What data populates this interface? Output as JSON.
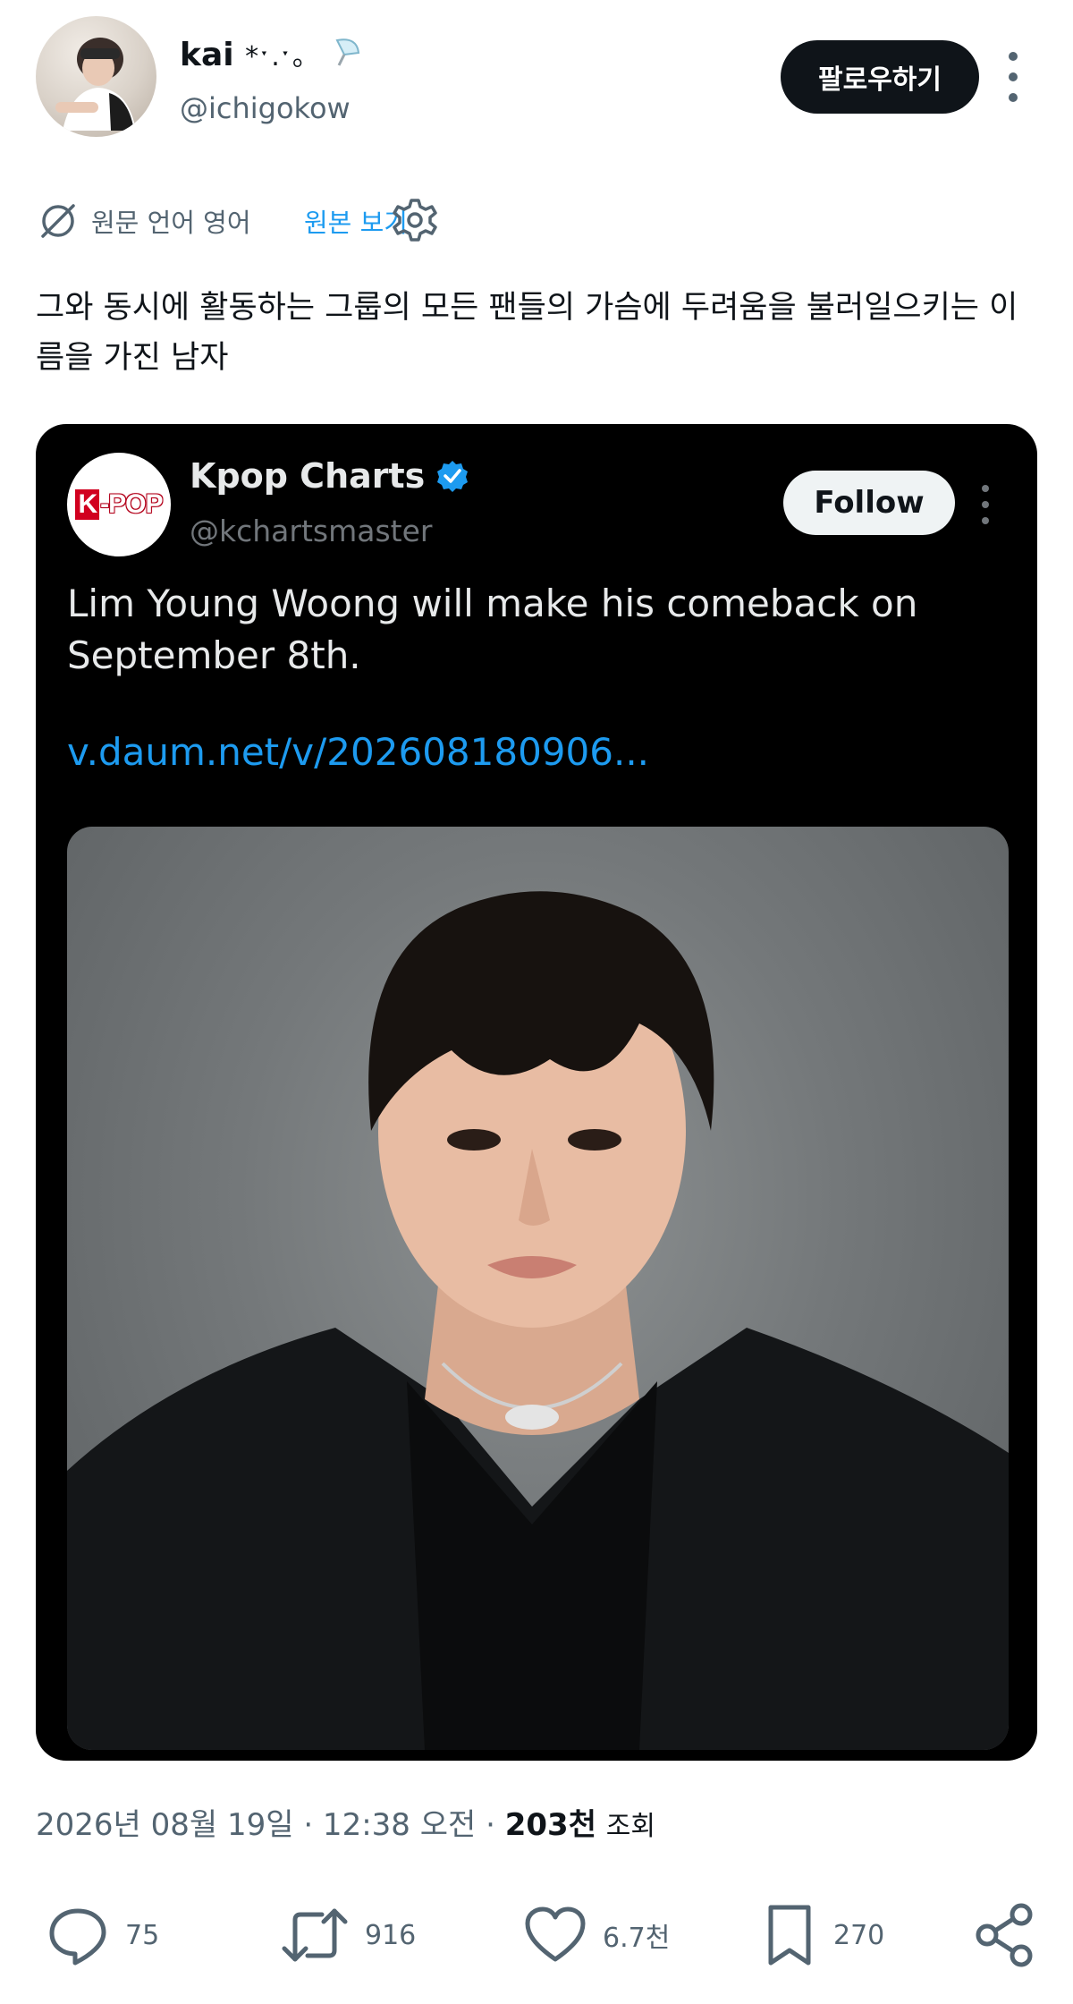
{
  "author": {
    "name": "kai",
    "name_decoration": "*ˑ.ˑ。",
    "handle": "@ichigokow",
    "follow_label": "팔로우하기"
  },
  "translation": {
    "text": "원문 언어 영어",
    "link": "원본 보기"
  },
  "tweet": {
    "text": "그와 동시에 활동하는 그룹의 모든 팬들의 가슴에 두려움을 불러일으키는 이름을 가진 남자"
  },
  "quote": {
    "avatar_logo_k": "K",
    "avatar_logo_rest": "-POP",
    "name": "Kpop Charts",
    "handle": "@kchartsmaster",
    "follow_label": "Follow",
    "text": "Lim Young Woong will make his comeback on September 8th.",
    "link": "v.daum.net/v/202608180906..."
  },
  "meta": {
    "datetime": "2026년 08월 19일 · 12:38 오전 · ",
    "views": "203천",
    "views_label": "조회"
  },
  "actions": {
    "replies": "75",
    "reposts": "916",
    "likes": "6.7천",
    "bookmarks": "270"
  },
  "colors": {
    "accent": "#1d9bf0",
    "text_primary": "#0f1419",
    "text_secondary": "#536471"
  }
}
